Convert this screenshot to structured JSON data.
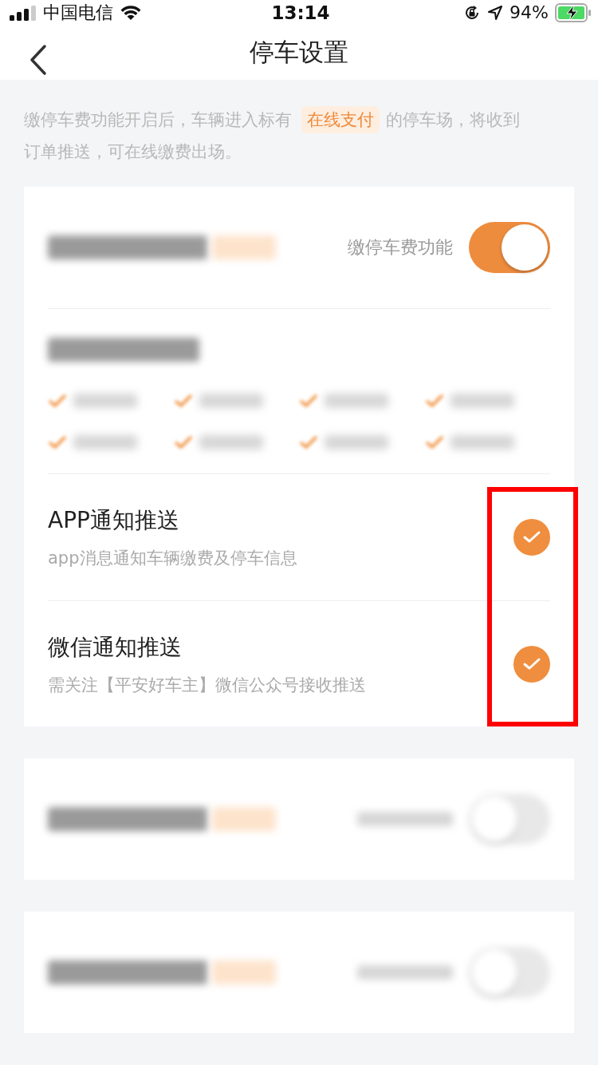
{
  "status_bar": {
    "carrier": "中国电信",
    "time": "13:14",
    "battery": "94%"
  },
  "nav": {
    "title": "停车设置"
  },
  "notice": {
    "before": "缴停车费功能开启后，车辆进入标有",
    "tag": "在线支付",
    "after": "的停车场，将收到",
    "line_2": "订单推送，可在线缴费出场。"
  },
  "cars": [
    {
      "toggle_label": "缴停车费功能",
      "on": true,
      "expanded": true
    },
    {
      "on": false,
      "expanded": false
    },
    {
      "on": false,
      "expanded": false
    }
  ],
  "notifications": [
    {
      "title": "APP通知推送",
      "subtitle": "app消息通知车辆缴费及停车信息",
      "checked": true
    },
    {
      "title": "微信通知推送",
      "subtitle": "需关注【平安好车主】微信公众号接收推送",
      "checked": true
    }
  ]
}
